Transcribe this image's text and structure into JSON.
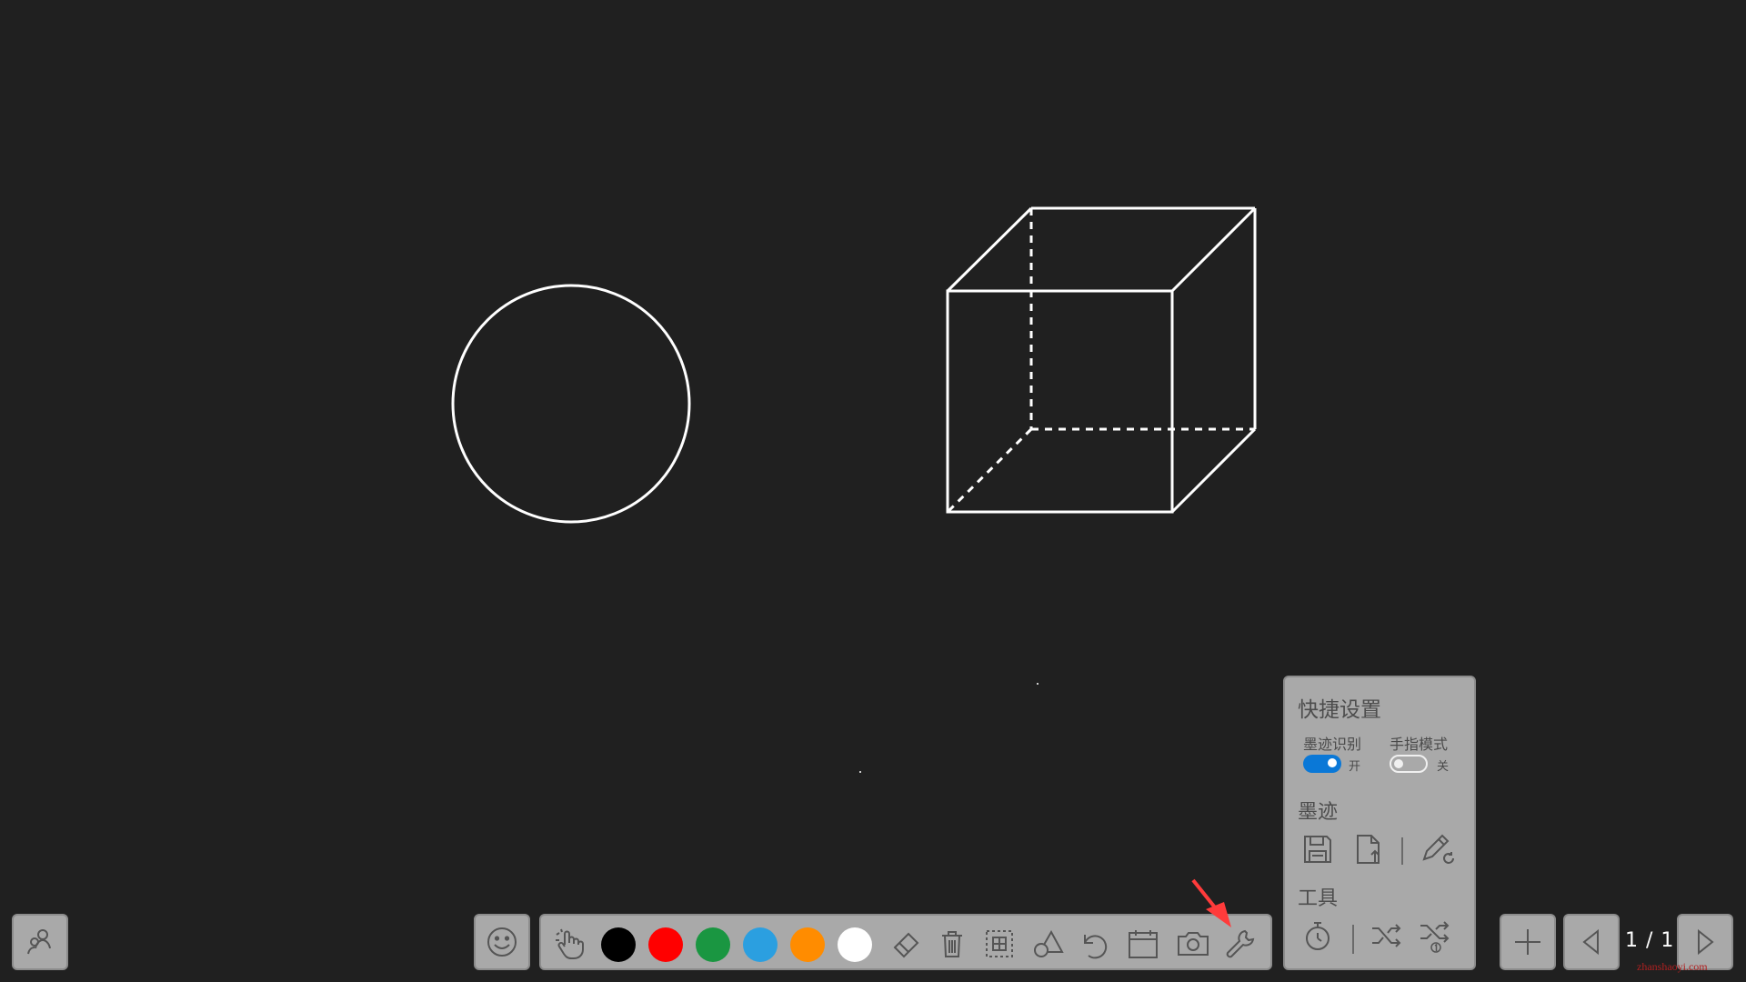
{
  "canvas": {
    "background": "#202020",
    "stroke_color": "#ffffff",
    "shapes": [
      "circle-shape",
      "cube-shape"
    ]
  },
  "toolbar": {
    "colors": [
      "#000000",
      "#ff0000",
      "#1a9641",
      "#2b9fe0",
      "#ff8c00",
      "#ffffff"
    ],
    "tools": [
      "hand-pointer-icon",
      "eraser-icon",
      "trash-icon",
      "select-icon",
      "shapes-icon",
      "undo-icon",
      "calendar-icon",
      "camera-icon",
      "wrench-icon"
    ]
  },
  "quick_settings": {
    "title": "快捷设置",
    "ink_recognition_label": "墨迹识别",
    "ink_recognition_state": "开",
    "ink_recognition_on": true,
    "finger_mode_label": "手指模式",
    "finger_mode_state": "关",
    "finger_mode_on": false,
    "ink_section": "墨迹",
    "tools_section": "工具",
    "accent_color": "#0a78d7"
  },
  "pager": {
    "indicator": "1 / 1"
  },
  "watermark": "zhanshaoyi.com",
  "annotation_arrow_color": "#ff3b3b"
}
